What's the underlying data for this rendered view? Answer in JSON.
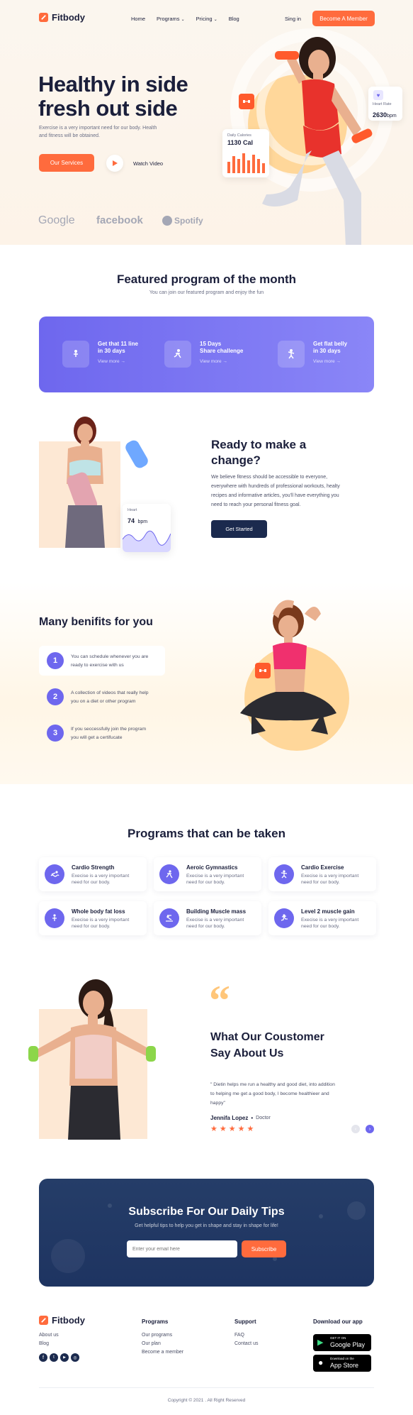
{
  "brand": {
    "name": "Fitbody",
    "accent": "#ff6b3d",
    "purple": "#6e67ee",
    "navy": "#1b2a4e"
  },
  "nav": {
    "items": [
      "Home",
      "Programs",
      "Pricing",
      "Blog"
    ],
    "signin": "Sing in",
    "cta": "Become A Member"
  },
  "hero": {
    "title_line1": "Healthy in side",
    "title_line2": "fresh out side",
    "subtitle_line1": "Exercise is a very important need for our body. Health",
    "subtitle_line2": "and fitness will be obtained.",
    "services_btn": "Our Services",
    "watch": "Watch Video",
    "calories_label": "Daily Calories",
    "calories_value": "1130 Cal",
    "heart_label": "Heart Rate",
    "heart_value": "2630",
    "heart_unit": "bpm",
    "partners": [
      "Google",
      "facebook",
      "Spotify"
    ]
  },
  "featured": {
    "title": "Featured program of the month",
    "subtitle": "You can join our featured program and enjoy the fun",
    "items": [
      {
        "line1": "Get that 11 line",
        "line2": "in 30 days",
        "link": "View more"
      },
      {
        "line1": "15 Days",
        "line2": "Share challenge",
        "link": "View more"
      },
      {
        "line1": "Get flat belly",
        "line2": "in 30 days",
        "link": "View more"
      }
    ]
  },
  "change": {
    "title_line1": "Ready to make a",
    "title_line2": "change?",
    "body_line1": "We believe fitness should be accessible to everyone,",
    "body_line2": "everywhere with hundreds of professional workouts, healty",
    "body_line3": "recipes and informative articles, you'll have everything you",
    "body_line4": "need to reach your personal fitness goal.",
    "cta": "Get Started",
    "heart_label": "Heart",
    "heart_value": "74",
    "heart_unit": "bpm"
  },
  "benefits": {
    "title": "Many benifits for you",
    "items": [
      {
        "num": "1",
        "line1": "You can schedule whenever you are",
        "line2": "ready to exercise with us"
      },
      {
        "num": "2",
        "line1": "A collection of videos that really help",
        "line2": "you on a diet or other program"
      },
      {
        "num": "3",
        "line1": "If you seccessfully join the program",
        "line2": "you will get a certifucate"
      }
    ]
  },
  "programs": {
    "title": "Programs that can be taken",
    "desc_line1": "Execise is a very important",
    "desc_line2": "need for our body.",
    "items": [
      "Cardio Strength",
      "Aeroic Gymnastics",
      "Cardio Exercise",
      "Whole body fat loss",
      "Building Muscle mass",
      "Level 2 muscle gain"
    ]
  },
  "testimonial": {
    "title_line1": "What Our Coustomer",
    "title_line2": "Say About Us",
    "quote_line1": "\" Dietin helps me run a healthy and good diet, into addition",
    "quote_line2": "to helping me get a good body, I become healthieer and",
    "quote_line3": "happy\"",
    "name": "Jennifa Lopez",
    "role": "Doctor",
    "stars": 5
  },
  "subscribe": {
    "title": "Subscribe For Our Daily Tips",
    "subtitle": "Get helpful tips to help you get in shape and stay in shape for life!",
    "placeholder": "Enter your email here",
    "btn": "Subscribe"
  },
  "footer": {
    "links": [
      "About us",
      "Blog"
    ],
    "programs_title": "Programs",
    "programs": [
      "Our programs",
      "Our plan",
      "Become a member"
    ],
    "support_title": "Support",
    "support": [
      "FAQ",
      "Contact us"
    ],
    "download_title": "Download our app",
    "gp_small": "GET IT ON",
    "gp_big": "Google Play",
    "as_small": "Download on the",
    "as_big": "App Store",
    "copyright": "Copyright © 2021 . All Right Reserved"
  }
}
